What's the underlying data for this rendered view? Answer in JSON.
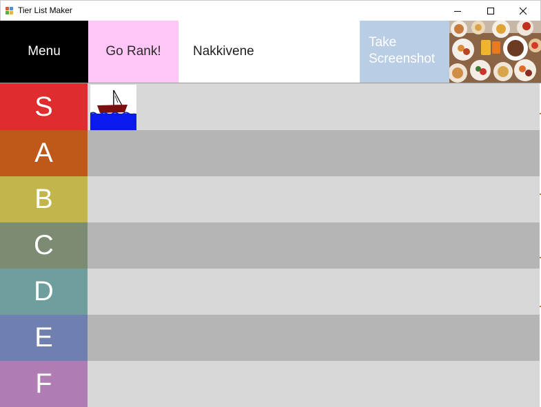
{
  "window": {
    "title": "Tier List Maker",
    "controls": [
      "minimize",
      "maximize",
      "close"
    ]
  },
  "toolbar": {
    "menu_label": "Menu",
    "rank_label": "Go Rank!",
    "list_name": "Nakkivene",
    "screenshot_line1": "Take",
    "screenshot_line2": "Screenshot",
    "image_icon": "food-buffet-photo"
  },
  "tiers": [
    {
      "label": "S",
      "color": "#df2d2f",
      "row_bg": "#d8d8d8",
      "items": [
        {
          "name": "sailboat-image"
        }
      ]
    },
    {
      "label": "A",
      "color": "#c0581a",
      "row_bg": "#b5b5b5",
      "items": []
    },
    {
      "label": "B",
      "color": "#c1b54c",
      "row_bg": "#d8d8d8",
      "items": []
    },
    {
      "label": "C",
      "color": "#7b8c72",
      "row_bg": "#b5b5b5",
      "items": []
    },
    {
      "label": "D",
      "color": "#6f9e9f",
      "row_bg": "#d8d8d8",
      "items": []
    },
    {
      "label": "E",
      "color": "#6f7faf",
      "row_bg": "#b5b5b5",
      "items": []
    },
    {
      "label": "F",
      "color": "#b07cb4",
      "row_bg": "#d8d8d8",
      "items": []
    }
  ]
}
